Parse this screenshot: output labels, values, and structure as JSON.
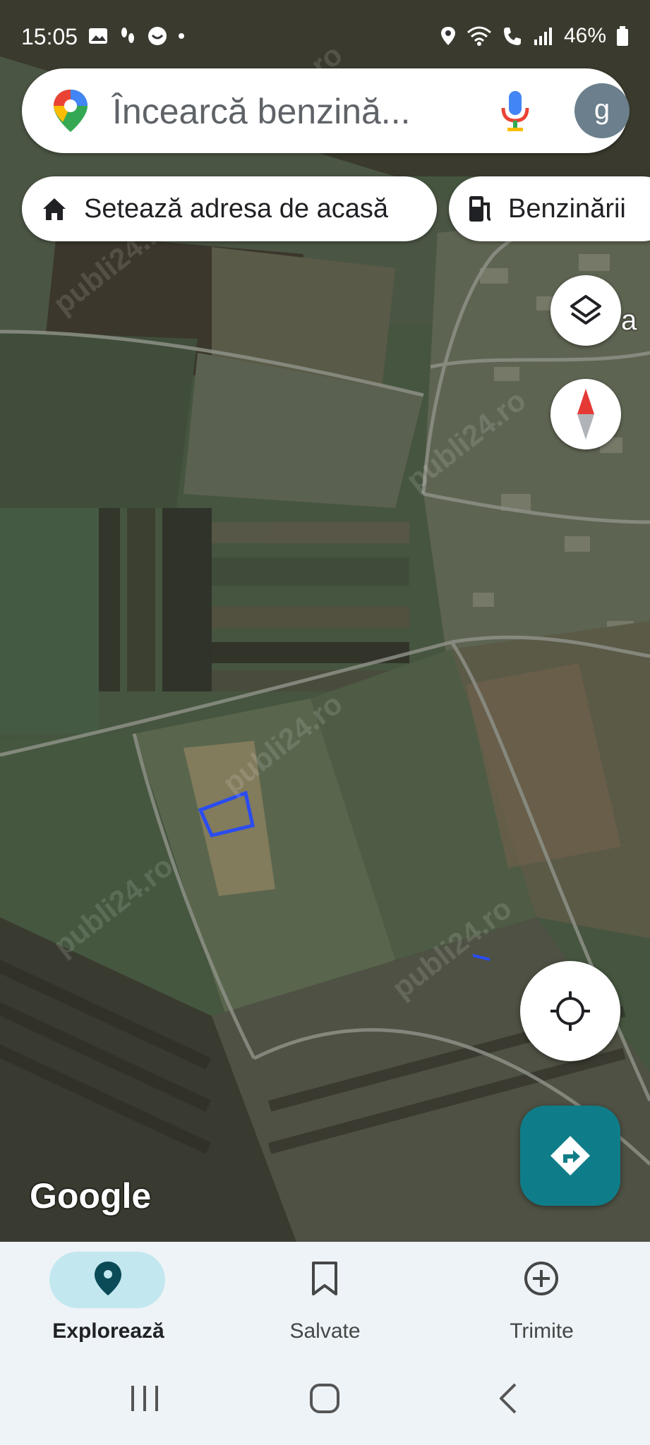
{
  "status_bar": {
    "time": "15:05",
    "battery": "46%",
    "left_icons": [
      "image-icon",
      "footprints-icon",
      "face-icon",
      "dot-icon"
    ],
    "right_icons": [
      "location-icon",
      "wifi-icon",
      "call-icon",
      "signal-icon",
      "battery-icon"
    ]
  },
  "search": {
    "placeholder": "Încearcă benzină...",
    "avatar_letter": "g"
  },
  "chips": [
    {
      "label": "Setează adresa de acasă",
      "icon": "home-icon"
    },
    {
      "label": "Benzinării",
      "icon": "gas-station-icon"
    }
  ],
  "map": {
    "edge_label_fragment": "a",
    "logo": "Google",
    "watermark": "publi24.ro",
    "parcel_color": "#2a4cf0"
  },
  "controls": {
    "layers": "layers-icon",
    "compass": "compass-icon",
    "my_location": "my-location-icon",
    "directions": "directions-icon"
  },
  "bottom_nav": [
    {
      "label": "Explorează",
      "icon": "explore-pin-icon",
      "active": true
    },
    {
      "label": "Salvate",
      "icon": "bookmark-icon",
      "active": false
    },
    {
      "label": "Trimite",
      "icon": "add-circle-icon",
      "active": false
    }
  ],
  "colors": {
    "accent_teal": "#0f7d89",
    "active_pill": "#c2e7ef",
    "nav_bg": "#eef3f7"
  }
}
